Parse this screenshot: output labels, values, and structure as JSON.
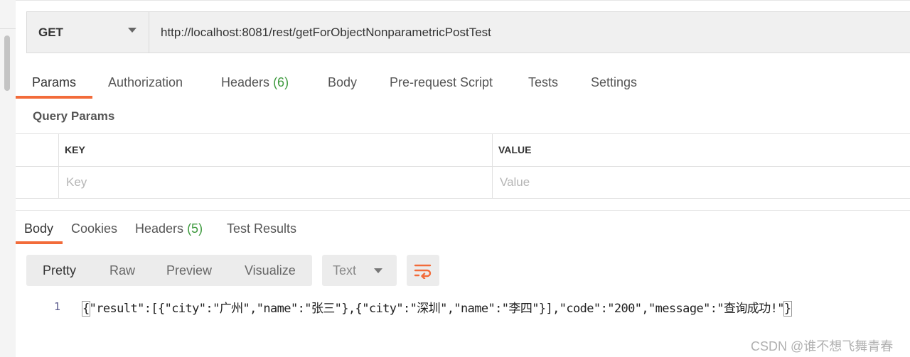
{
  "request": {
    "method": "GET",
    "url": "http://localhost:8081/rest/getForObjectNonparametricPostTest"
  },
  "request_tabs": [
    {
      "label": "Params",
      "active": true
    },
    {
      "label": "Authorization"
    },
    {
      "label": "Headers",
      "count": "(6)"
    },
    {
      "label": "Body"
    },
    {
      "label": "Pre-request Script"
    },
    {
      "label": "Tests"
    },
    {
      "label": "Settings"
    }
  ],
  "query_params": {
    "title": "Query Params",
    "columns": [
      "KEY",
      "VALUE"
    ],
    "placeholders": {
      "key": "Key",
      "value": "Value"
    }
  },
  "response_tabs": [
    {
      "label": "Body",
      "active": true
    },
    {
      "label": "Cookies"
    },
    {
      "label": "Headers",
      "count": "(5)"
    },
    {
      "label": "Test Results"
    }
  ],
  "response_toolbar": {
    "views": [
      "Pretty",
      "Raw",
      "Preview",
      "Visualize"
    ],
    "active_view": "Pretty",
    "format": "Text",
    "wrap_icon": "wrap-lines-icon"
  },
  "response_body": {
    "line_number": "1",
    "open_brace": "{",
    "content": "\"result\":[{\"city\":\"广州\",\"name\":\"张三\"},{\"city\":\"深圳\",\"name\":\"李四\"}],\"code\":\"200\",\"message\":\"查询成功!\"",
    "close_brace": "}"
  },
  "watermark": "CSDN @谁不想飞舞青春",
  "colors": {
    "accent": "#f26b3a",
    "count_green": "#3e9a3e"
  }
}
